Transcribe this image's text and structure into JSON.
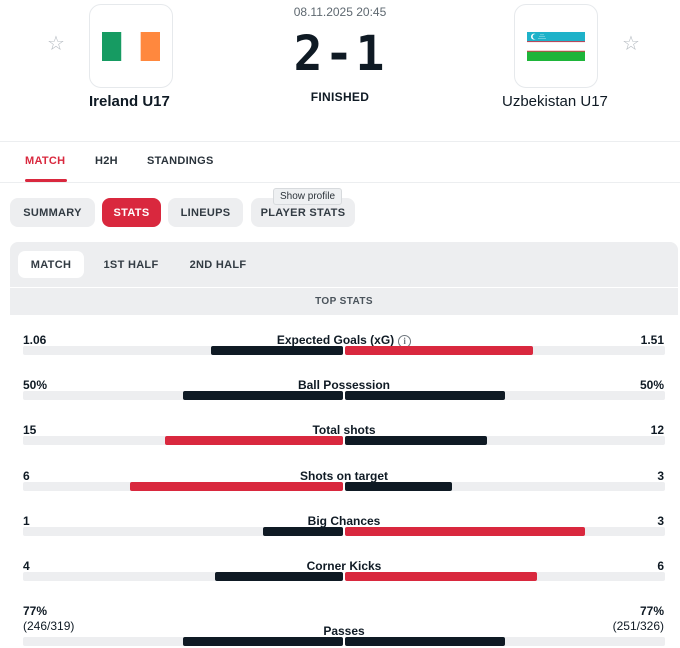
{
  "match": {
    "datetime": "08.11.2025 20:45",
    "score": "2-1",
    "status": "FINISHED",
    "home": {
      "name": "Ireland U17",
      "flag": "ireland-flag"
    },
    "away": {
      "name": "Uzbekistan U17",
      "flag": "uzbekistan-flag"
    }
  },
  "tabs": [
    {
      "label": "MATCH",
      "active": true
    },
    {
      "label": "H2H",
      "active": false
    },
    {
      "label": "STANDINGS",
      "active": false
    }
  ],
  "subtabs": [
    {
      "label": "SUMMARY",
      "active": false
    },
    {
      "label": "STATS",
      "active": true
    },
    {
      "label": "LINEUPS",
      "active": false
    },
    {
      "label": "PLAYER STATS",
      "active": false
    }
  ],
  "tooltip": "Show profile",
  "periods": [
    {
      "label": "MATCH",
      "active": true
    },
    {
      "label": "1ST HALF",
      "active": false
    },
    {
      "label": "2ND HALF",
      "active": false
    }
  ],
  "section_title": "TOP STATS",
  "colors": {
    "accent": "#d9283e",
    "dark": "#0f1a24",
    "track": "#edeef0"
  },
  "stats": [
    {
      "name": "Expected Goals (xG)",
      "home": "1.06",
      "away": "1.51",
      "home_share": 0.412,
      "away_share": 0.588,
      "leader": "away",
      "info": "i"
    },
    {
      "name": "Ball Possession",
      "home": "50%",
      "away": "50%",
      "home_share": 0.5,
      "away_share": 0.5,
      "leader": "none"
    },
    {
      "name": "Total shots",
      "home": "15",
      "away": "12",
      "home_share": 0.556,
      "away_share": 0.444,
      "leader": "home"
    },
    {
      "name": "Shots on target",
      "home": "6",
      "away": "3",
      "home_share": 0.667,
      "away_share": 0.333,
      "leader": "home"
    },
    {
      "name": "Big Chances",
      "home": "1",
      "away": "3",
      "home_share": 0.25,
      "away_share": 0.75,
      "leader": "away"
    },
    {
      "name": "Corner Kicks",
      "home": "4",
      "away": "6",
      "home_share": 0.4,
      "away_share": 0.6,
      "leader": "away"
    },
    {
      "name": "Passes",
      "home": "77%",
      "home_detail": "(246/319)",
      "away": "77%",
      "away_detail": "(251/326)",
      "home_share": 0.5,
      "away_share": 0.5,
      "leader": "none"
    }
  ]
}
